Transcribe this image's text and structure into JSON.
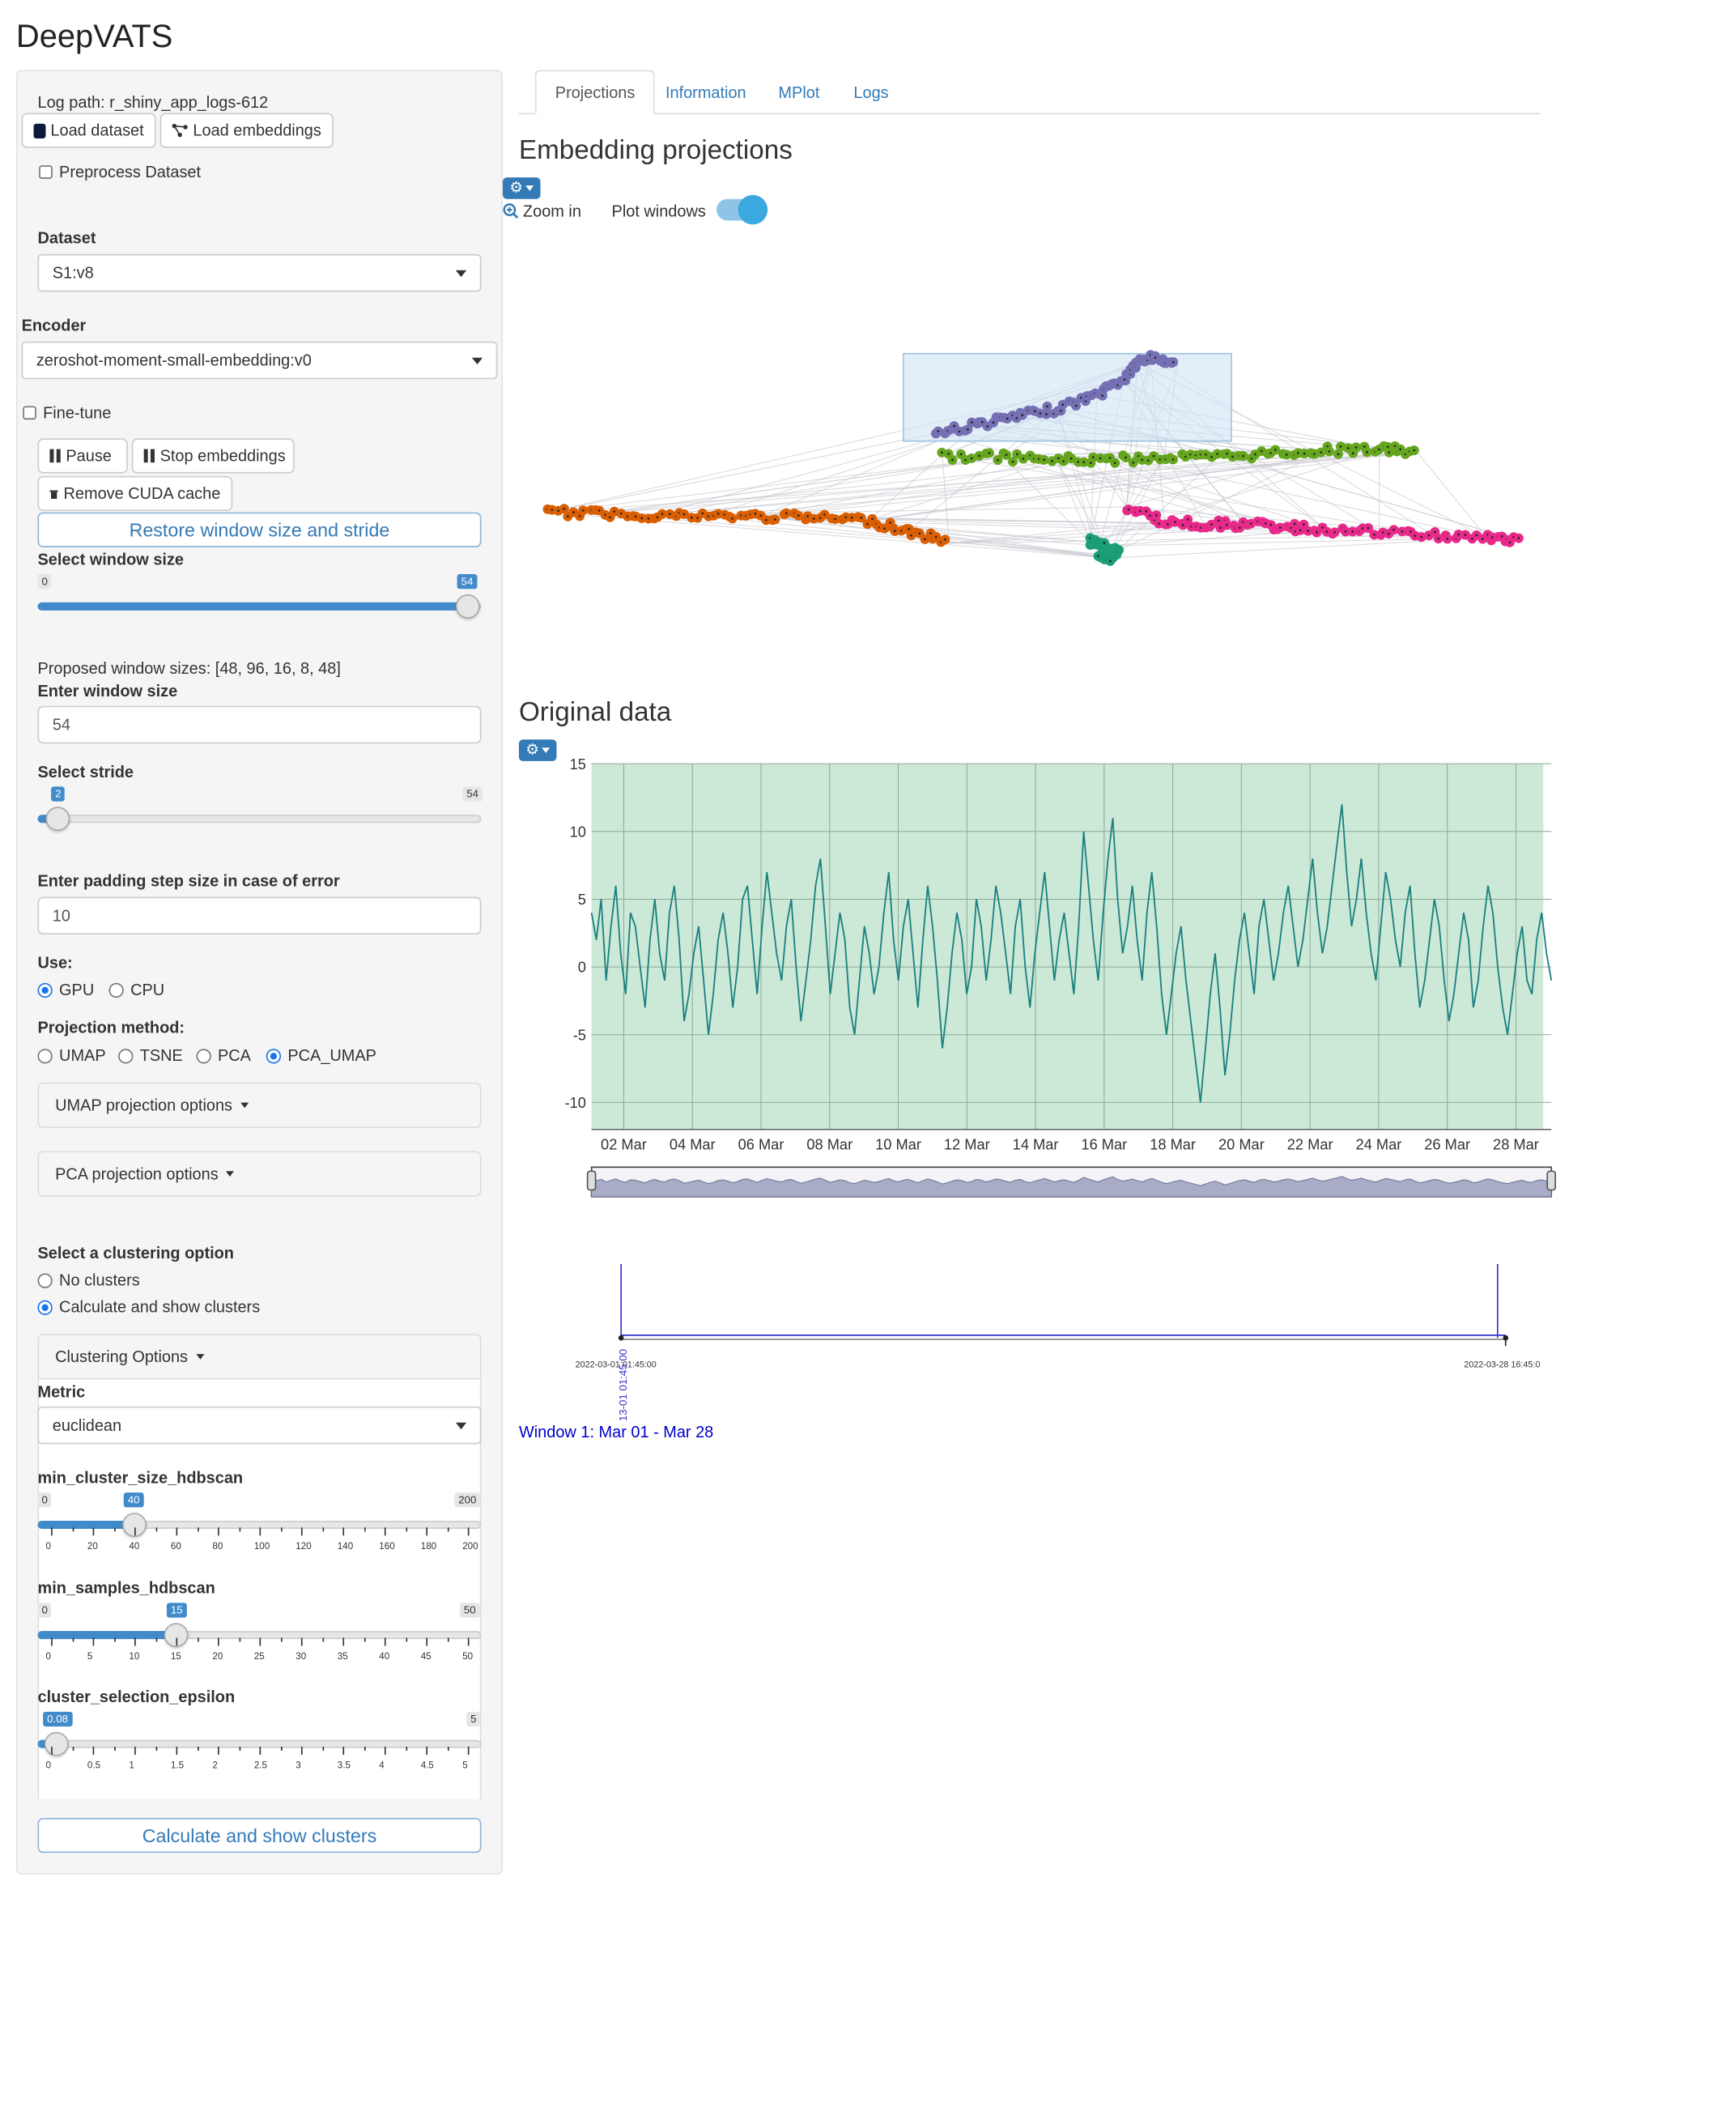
{
  "app": {
    "title": "DeepVATS"
  },
  "sidebar": {
    "log_path": "Log path: r_shiny_app_logs-612",
    "load_dataset": "Load dataset",
    "load_embeddings": "Load embeddings",
    "preprocess_label": "Preprocess Dataset",
    "dataset_label": "Dataset",
    "dataset_value": "S1:v8",
    "encoder_label": "Encoder",
    "encoder_value": "zeroshot-moment-small-embedding:v0",
    "finetune_label": "Fine-tune",
    "pause": "Pause",
    "stop_embeddings": "Stop embeddings",
    "remove_cuda": "Remove CUDA cache",
    "restore_window": "Restore window size and stride",
    "window_size_label": "Select window size",
    "window_size": {
      "min": "0",
      "max": "54",
      "value": "54",
      "fraction": 1.0
    },
    "proposed_sizes": "Proposed window sizes: [48, 96, 16, 8, 48]",
    "enter_window_label": "Enter window size",
    "enter_window_value": "54",
    "stride_label": "Select stride",
    "stride": {
      "min": "0",
      "max": "54",
      "value": "2",
      "fraction": 0.037
    },
    "padding_label": "Enter padding step size in case of error",
    "padding_value": "10",
    "use_label": "Use:",
    "use_options": [
      "GPU",
      "CPU"
    ],
    "use_selected": "GPU",
    "projection_label": "Projection method:",
    "projection_options": [
      "UMAP",
      "TSNE",
      "PCA",
      "PCA_UMAP"
    ],
    "projection_selected": "PCA_UMAP",
    "umap_options": "UMAP projection options",
    "pca_options": "PCA projection options",
    "clustering_label": "Select a clustering option",
    "clustering_options": [
      "No clusters",
      "Calculate and show clusters"
    ],
    "clustering_selected": "Calculate and show clusters",
    "clustering_panel": "Clustering Options",
    "metric_label": "Metric",
    "metric_value": "euclidean",
    "min_cluster_label": "min_cluster_size_hdbscan",
    "min_cluster": {
      "min": "0",
      "max": "200",
      "value": "40",
      "fraction": 0.2,
      "ticks": [
        "0",
        "20",
        "40",
        "60",
        "80",
        "100",
        "120",
        "140",
        "160",
        "180",
        "200"
      ]
    },
    "min_samples_label": "min_samples_hdbscan",
    "min_samples": {
      "min": "0",
      "max": "50",
      "value": "15",
      "fraction": 0.3,
      "ticks": [
        "0",
        "5",
        "10",
        "15",
        "20",
        "25",
        "30",
        "35",
        "40",
        "45",
        "50"
      ]
    },
    "epsilon_label": "cluster_selection_epsilon",
    "epsilon": {
      "min": "0",
      "max": "5",
      "value": "0.08",
      "fraction": 0.016,
      "ticks": [
        "0",
        "0.5",
        "1",
        "1.5",
        "2",
        "2.5",
        "3",
        "3.5",
        "4",
        "4.5",
        "5"
      ]
    },
    "calc_button": "Calculate and show clusters"
  },
  "tabs": [
    "Projections",
    "Information",
    "MPlot",
    "Logs"
  ],
  "active_tab": "Projections",
  "projections": {
    "title": "Embedding projections",
    "zoom_in": "Zoom in",
    "plot_windows": "Plot windows",
    "plot_windows_on": true,
    "cluster_colors": [
      "#7570b3",
      "#66a61e",
      "#d95f02",
      "#e7298a",
      "#1b9e77"
    ]
  },
  "original": {
    "title": "Original data",
    "y_ticks": [
      "15",
      "10",
      "5",
      "0",
      "-5",
      "-10"
    ],
    "x_ticks": [
      "02 Mar",
      "04 Mar",
      "06 Mar",
      "08 Mar",
      "10 Mar",
      "12 Mar",
      "14 Mar",
      "16 Mar",
      "18 Mar",
      "20 Mar",
      "22 Mar",
      "24 Mar",
      "26 Mar",
      "28 Mar"
    ],
    "bg_color": "#cce8d6",
    "line_color": "#1a8080"
  },
  "timeline": {
    "start_label": "2022-03-01 01:45:00",
    "end_label": "2022-03-28 16:45:0",
    "rotated_label": "13-01 01:45:00",
    "window_text": "Window 1: Mar 01 - Mar 28"
  },
  "chart_data": {
    "type": "line",
    "title": "Original data",
    "xlabel": "",
    "ylabel": "",
    "ylim": [
      -12,
      15
    ],
    "x_range": [
      "2022-03-01 01:45:00",
      "2022-03-28 16:45:00"
    ],
    "x_ticks": [
      "02 Mar",
      "04 Mar",
      "06 Mar",
      "08 Mar",
      "10 Mar",
      "12 Mar",
      "14 Mar",
      "16 Mar",
      "18 Mar",
      "20 Mar",
      "22 Mar",
      "24 Mar",
      "26 Mar",
      "28 Mar"
    ],
    "y_ticks": [
      15,
      10,
      5,
      0,
      -5,
      -10
    ],
    "series": [
      {
        "values": [
          4,
          2,
          5,
          -1,
          3,
          6,
          1,
          -2,
          4,
          3,
          0,
          -3,
          2,
          5,
          1,
          -1,
          4,
          6,
          2,
          -4,
          -2,
          1,
          3,
          -1,
          -5,
          -2,
          2,
          4,
          1,
          -3,
          0,
          5,
          6,
          2,
          -2,
          3,
          7,
          4,
          1,
          -1,
          3,
          5,
          0,
          -4,
          -1,
          2,
          6,
          8,
          3,
          -2,
          1,
          4,
          2,
          -3,
          -5,
          -1,
          3,
          1,
          -2,
          0,
          4,
          7,
          2,
          -1,
          3,
          5,
          1,
          -3,
          2,
          6,
          3,
          -1,
          -6,
          -3,
          1,
          4,
          2,
          -2,
          0,
          5,
          3,
          -1,
          2,
          6,
          4,
          1,
          -2,
          3,
          5,
          0,
          -3,
          1,
          4,
          7,
          3,
          -1,
          2,
          4,
          1,
          -2,
          3,
          10,
          6,
          2,
          -1,
          4,
          8,
          11,
          5,
          1,
          3,
          6,
          2,
          -1,
          4,
          7,
          3,
          -2,
          -5,
          -2,
          1,
          3,
          -1,
          -4,
          -7,
          -10,
          -6,
          -2,
          1,
          -3,
          -8,
          -5,
          -1,
          2,
          4,
          1,
          -2,
          3,
          5,
          2,
          -1,
          1,
          4,
          6,
          3,
          0,
          2,
          5,
          8,
          4,
          1,
          3,
          6,
          9,
          12,
          7,
          3,
          5,
          8,
          4,
          1,
          -1,
          3,
          7,
          5,
          2,
          0,
          4,
          6,
          1,
          -3,
          -1,
          2,
          5,
          3,
          -1,
          -4,
          -2,
          1,
          4,
          2,
          -3,
          -1,
          3,
          6,
          4,
          0,
          -3,
          -5,
          -2,
          1,
          3,
          -1,
          -2,
          2,
          4,
          1,
          -1
        ]
      }
    ]
  }
}
